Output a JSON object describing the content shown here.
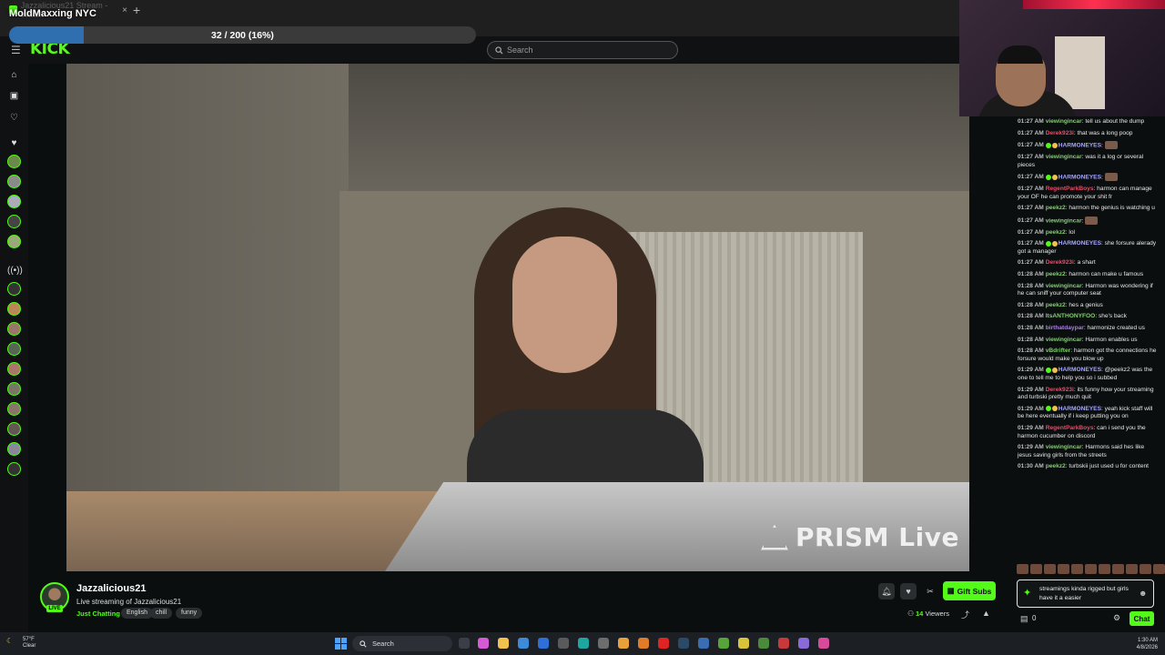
{
  "browser": {
    "tab_title": "Jazzalicious21 Stream - Watch",
    "close_glyph": "×",
    "new_tab_glyph": "+"
  },
  "overlay": {
    "title": "MoldMaxxing NYC",
    "goal_text": "32 / 200 (16%)",
    "goal_fraction": 0.16,
    "goal_color": "#2f6fb0"
  },
  "header": {
    "logo": "KICK",
    "search_placeholder": "Search",
    "accent": "#53fc18"
  },
  "video": {
    "watermark": "PRISM Live"
  },
  "chat": {
    "messages": [
      {
        "time": "01:27 AM",
        "user": "viewingincar",
        "color": "#7fd36a",
        "text": "tell us about the dump"
      },
      {
        "time": "01:27 AM",
        "user": "Derek923i",
        "color": "#e0506a",
        "text": "that was a long poop"
      },
      {
        "time": "01:27 AM",
        "user": "HARMONEYES",
        "color": "#a6a6ff",
        "text": ""
      },
      {
        "time": "01:27 AM",
        "user": "viewingincar",
        "color": "#7fd36a",
        "text": "was it a log or several pieces"
      },
      {
        "time": "01:27 AM",
        "user": "HARMONEYES",
        "color": "#a6a6ff",
        "text": ""
      },
      {
        "time": "01:27 AM",
        "user": "RegentParkBoys",
        "color": "#e0506a",
        "text": "harmon can manage your OF he can promote your shit fr"
      },
      {
        "time": "01:27 AM",
        "user": "peekz2",
        "color": "#7fd36a",
        "text": "harmon the genius is watching u"
      },
      {
        "time": "01:27 AM",
        "user": "viewingincar",
        "color": "#7fd36a",
        "text": ""
      },
      {
        "time": "01:27 AM",
        "user": "peekz2",
        "color": "#7fd36a",
        "text": "lol"
      },
      {
        "time": "01:27 AM",
        "user": "HARMONEYES",
        "color": "#a6a6ff",
        "text": "she forsure alerady got a manager"
      },
      {
        "time": "01:27 AM",
        "user": "Derek923i",
        "color": "#e0506a",
        "text": "a shart"
      },
      {
        "time": "01:28 AM",
        "user": "peekz2",
        "color": "#7fd36a",
        "text": "harmon can make u famous"
      },
      {
        "time": "01:28 AM",
        "user": "viewingincar",
        "color": "#7fd36a",
        "text": "Harmon was wondering if he can sniff your computer seat"
      },
      {
        "time": "01:28 AM",
        "user": "peekz2",
        "color": "#7fd36a",
        "text": "hes a genius"
      },
      {
        "time": "01:28 AM",
        "user": "ItsANTHONYFOO",
        "color": "#7fd36a",
        "text": "she's back"
      },
      {
        "time": "01:28 AM",
        "user": "birthatdaypar",
        "color": "#b07cf0",
        "text": "harmonize created us"
      },
      {
        "time": "01:28 AM",
        "user": "viewingincar",
        "color": "#7fd36a",
        "text": "Harmon enables us"
      },
      {
        "time": "01:28 AM",
        "user": "vBdrifter",
        "color": "#7fd36a",
        "text": "harmon got the connections he forsure would make you blow up"
      },
      {
        "time": "01:29 AM",
        "user": "HARMONEYES",
        "color": "#a6a6ff",
        "text": "@peekz2 was the one to tell me to help you so i subbed"
      },
      {
        "time": "01:29 AM",
        "user": "Derek923i",
        "color": "#e0506a",
        "text": "its funny how your streaming and turbski pretty much quit"
      },
      {
        "time": "01:29 AM",
        "user": "HARMONEYES",
        "color": "#a6a6ff",
        "text": "yeah kick staff will be here eventually if i keep putting you on"
      },
      {
        "time": "01:29 AM",
        "user": "RegentParkBoys",
        "color": "#e0506a",
        "text": "can i send you the harmon cucumber on discord"
      },
      {
        "time": "01:29 AM",
        "user": "viewingincar",
        "color": "#7fd36a",
        "text": "Harmons said hes like jesus saving girls from the streets"
      },
      {
        "time": "01:30 AM",
        "user": "peekz2",
        "color": "#7fd36a",
        "text": "turbskii just used u for content"
      }
    ],
    "input_text": "streamings kinda rigged but girls have it a easier",
    "points": "0",
    "send_label": "Chat"
  },
  "stream": {
    "name": "Jazzalicious21",
    "title": "Live streaming of Jazzalicious21",
    "live_label": "LIVE",
    "category": "Just Chatting",
    "tags": [
      "English",
      "chill",
      "funny"
    ],
    "gift_label": "Gift Subs",
    "viewers_count": "14",
    "viewers_label": "Viewers"
  },
  "taskbar": {
    "weather_temp": "57°F",
    "weather_cond": "Clear",
    "search_placeholder": "Search",
    "time": "1:30 AM",
    "date": "4/8/2026"
  }
}
